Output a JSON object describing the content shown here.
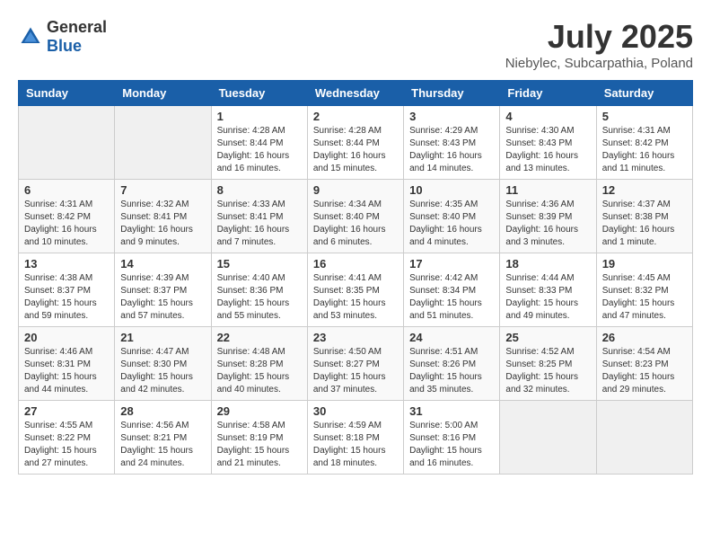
{
  "header": {
    "logo": {
      "general": "General",
      "blue": "Blue"
    },
    "title": "July 2025",
    "location": "Niebylec, Subcarpathia, Poland"
  },
  "calendar": {
    "days_of_week": [
      "Sunday",
      "Monday",
      "Tuesday",
      "Wednesday",
      "Thursday",
      "Friday",
      "Saturday"
    ],
    "weeks": [
      [
        {
          "day": "",
          "info": ""
        },
        {
          "day": "",
          "info": ""
        },
        {
          "day": "1",
          "info": "Sunrise: 4:28 AM\nSunset: 8:44 PM\nDaylight: 16 hours\nand 16 minutes."
        },
        {
          "day": "2",
          "info": "Sunrise: 4:28 AM\nSunset: 8:44 PM\nDaylight: 16 hours\nand 15 minutes."
        },
        {
          "day": "3",
          "info": "Sunrise: 4:29 AM\nSunset: 8:43 PM\nDaylight: 16 hours\nand 14 minutes."
        },
        {
          "day": "4",
          "info": "Sunrise: 4:30 AM\nSunset: 8:43 PM\nDaylight: 16 hours\nand 13 minutes."
        },
        {
          "day": "5",
          "info": "Sunrise: 4:31 AM\nSunset: 8:42 PM\nDaylight: 16 hours\nand 11 minutes."
        }
      ],
      [
        {
          "day": "6",
          "info": "Sunrise: 4:31 AM\nSunset: 8:42 PM\nDaylight: 16 hours\nand 10 minutes."
        },
        {
          "day": "7",
          "info": "Sunrise: 4:32 AM\nSunset: 8:41 PM\nDaylight: 16 hours\nand 9 minutes."
        },
        {
          "day": "8",
          "info": "Sunrise: 4:33 AM\nSunset: 8:41 PM\nDaylight: 16 hours\nand 7 minutes."
        },
        {
          "day": "9",
          "info": "Sunrise: 4:34 AM\nSunset: 8:40 PM\nDaylight: 16 hours\nand 6 minutes."
        },
        {
          "day": "10",
          "info": "Sunrise: 4:35 AM\nSunset: 8:40 PM\nDaylight: 16 hours\nand 4 minutes."
        },
        {
          "day": "11",
          "info": "Sunrise: 4:36 AM\nSunset: 8:39 PM\nDaylight: 16 hours\nand 3 minutes."
        },
        {
          "day": "12",
          "info": "Sunrise: 4:37 AM\nSunset: 8:38 PM\nDaylight: 16 hours\nand 1 minute."
        }
      ],
      [
        {
          "day": "13",
          "info": "Sunrise: 4:38 AM\nSunset: 8:37 PM\nDaylight: 15 hours\nand 59 minutes."
        },
        {
          "day": "14",
          "info": "Sunrise: 4:39 AM\nSunset: 8:37 PM\nDaylight: 15 hours\nand 57 minutes."
        },
        {
          "day": "15",
          "info": "Sunrise: 4:40 AM\nSunset: 8:36 PM\nDaylight: 15 hours\nand 55 minutes."
        },
        {
          "day": "16",
          "info": "Sunrise: 4:41 AM\nSunset: 8:35 PM\nDaylight: 15 hours\nand 53 minutes."
        },
        {
          "day": "17",
          "info": "Sunrise: 4:42 AM\nSunset: 8:34 PM\nDaylight: 15 hours\nand 51 minutes."
        },
        {
          "day": "18",
          "info": "Sunrise: 4:44 AM\nSunset: 8:33 PM\nDaylight: 15 hours\nand 49 minutes."
        },
        {
          "day": "19",
          "info": "Sunrise: 4:45 AM\nSunset: 8:32 PM\nDaylight: 15 hours\nand 47 minutes."
        }
      ],
      [
        {
          "day": "20",
          "info": "Sunrise: 4:46 AM\nSunset: 8:31 PM\nDaylight: 15 hours\nand 44 minutes."
        },
        {
          "day": "21",
          "info": "Sunrise: 4:47 AM\nSunset: 8:30 PM\nDaylight: 15 hours\nand 42 minutes."
        },
        {
          "day": "22",
          "info": "Sunrise: 4:48 AM\nSunset: 8:28 PM\nDaylight: 15 hours\nand 40 minutes."
        },
        {
          "day": "23",
          "info": "Sunrise: 4:50 AM\nSunset: 8:27 PM\nDaylight: 15 hours\nand 37 minutes."
        },
        {
          "day": "24",
          "info": "Sunrise: 4:51 AM\nSunset: 8:26 PM\nDaylight: 15 hours\nand 35 minutes."
        },
        {
          "day": "25",
          "info": "Sunrise: 4:52 AM\nSunset: 8:25 PM\nDaylight: 15 hours\nand 32 minutes."
        },
        {
          "day": "26",
          "info": "Sunrise: 4:54 AM\nSunset: 8:23 PM\nDaylight: 15 hours\nand 29 minutes."
        }
      ],
      [
        {
          "day": "27",
          "info": "Sunrise: 4:55 AM\nSunset: 8:22 PM\nDaylight: 15 hours\nand 27 minutes."
        },
        {
          "day": "28",
          "info": "Sunrise: 4:56 AM\nSunset: 8:21 PM\nDaylight: 15 hours\nand 24 minutes."
        },
        {
          "day": "29",
          "info": "Sunrise: 4:58 AM\nSunset: 8:19 PM\nDaylight: 15 hours\nand 21 minutes."
        },
        {
          "day": "30",
          "info": "Sunrise: 4:59 AM\nSunset: 8:18 PM\nDaylight: 15 hours\nand 18 minutes."
        },
        {
          "day": "31",
          "info": "Sunrise: 5:00 AM\nSunset: 8:16 PM\nDaylight: 15 hours\nand 16 minutes."
        },
        {
          "day": "",
          "info": ""
        },
        {
          "day": "",
          "info": ""
        }
      ]
    ]
  }
}
